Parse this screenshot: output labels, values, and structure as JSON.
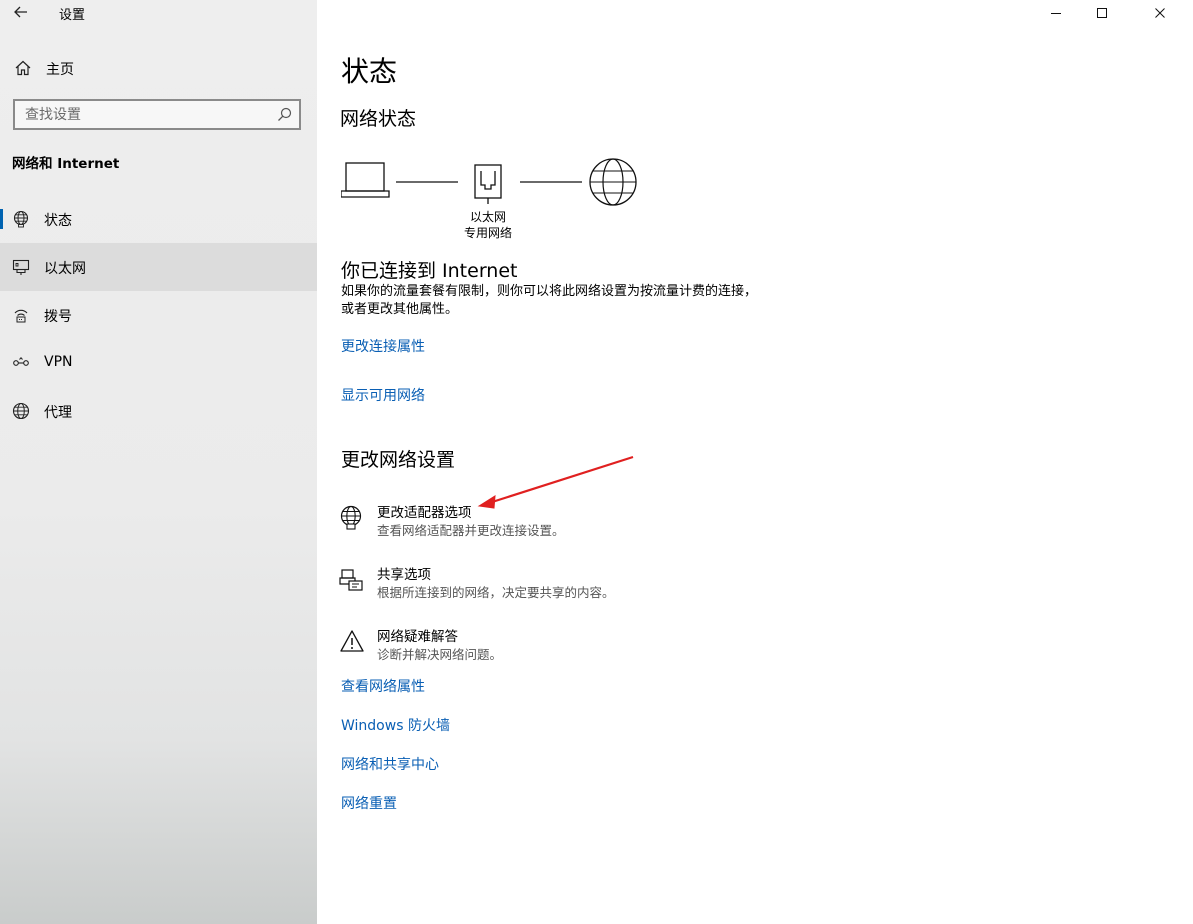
{
  "titlebar": {
    "back_icon": "back-arrow-icon",
    "title": "设置"
  },
  "sidebar": {
    "home_label": "主页",
    "search_placeholder": "查找设置",
    "section_heading": "网络和 Internet",
    "items": [
      {
        "label": "状态",
        "icon": "globe-status-icon",
        "selected": false
      },
      {
        "label": "以太网",
        "icon": "ethernet-icon",
        "selected": true
      },
      {
        "label": "拨号",
        "icon": "dialup-icon",
        "selected": false
      },
      {
        "label": "VPN",
        "icon": "vpn-icon",
        "selected": false
      },
      {
        "label": "代理",
        "icon": "globe-icon",
        "selected": false
      }
    ]
  },
  "window_controls": [
    "minimize",
    "maximize",
    "close"
  ],
  "main": {
    "title": "状态",
    "network_status_heading": "网络状态",
    "diagram": {
      "label_line1": "以太网",
      "label_line2": "专用网络"
    },
    "connected_title": "你已连接到 Internet",
    "connected_desc": "如果你的流量套餐有限制，则你可以将此网络设置为按流量计费的连接，或者更改其他属性。",
    "links_top": [
      "更改连接属性",
      "显示可用网络"
    ],
    "change_heading": "更改网络设置",
    "options": [
      {
        "title": "更改适配器选项",
        "subtitle": "查看网络适配器并更改连接设置。",
        "icon": "adapter-icon"
      },
      {
        "title": "共享选项",
        "subtitle": "根据所连接到的网络，决定要共享的内容。",
        "icon": "sharing-icon"
      },
      {
        "title": "网络疑难解答",
        "subtitle": "诊断并解决网络问题。",
        "icon": "warning-icon"
      }
    ],
    "links_bottom": [
      "查看网络属性",
      "Windows 防火墙",
      "网络和共享中心",
      "网络重置"
    ]
  },
  "colors": {
    "link": "#0a5fb4",
    "accent": "#0063b1",
    "annotation_arrow": "#e02020"
  }
}
